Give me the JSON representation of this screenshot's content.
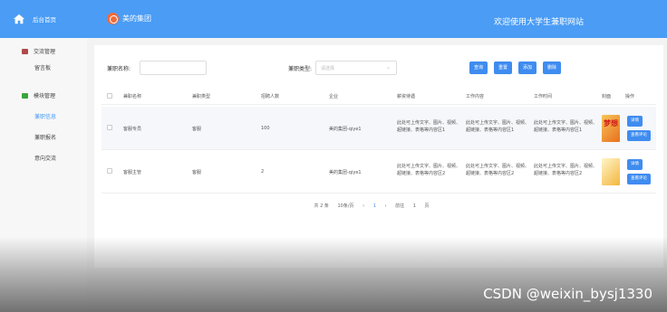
{
  "sidebar": {
    "home_label": "后台首页",
    "groups": [
      {
        "label": "交流管理",
        "items": [
          "留言板"
        ]
      },
      {
        "label": "模块管理",
        "items": [
          "兼职信息",
          "兼职报名",
          "意向交流"
        ]
      }
    ],
    "active_item": "兼职信息"
  },
  "header": {
    "brand": "美的集团",
    "welcome": "欢迎使用大学生兼职网站"
  },
  "search": {
    "name_label": "兼职名称:",
    "name_value": "",
    "type_label": "兼职类型:",
    "type_placeholder": "请选择",
    "buttons": [
      "查询",
      "重置",
      "添加",
      "删除"
    ]
  },
  "table": {
    "columns": [
      "兼职名称",
      "兼职类型",
      "招聘人数",
      "企业",
      "薪资待遇",
      "工作内容",
      "工作时间",
      "封面",
      "操作"
    ],
    "rows": [
      {
        "name": "客服专员",
        "type": "客服",
        "count": "100",
        "company": "美的集团-qiye1",
        "salary": "此处可上传文字、图片、视频、超链接、表格等内容区1",
        "content": "此处可上传文字、图片、视频、超链接、表格等内容区1",
        "time": "此处可上传文字、图片、视频、超链接、表格等内容区1",
        "cover_text": "梦想",
        "actions": [
          "详情",
          "查看评论"
        ]
      },
      {
        "name": "客服主管",
        "type": "客服",
        "count": "2",
        "company": "美的集团-qiye1",
        "salary": "此处可上传文字、图片、视频、超链接、表格等内容区2",
        "content": "此处可上传文字、图片、视频、超链接、表格等内容区2",
        "time": "此处可上传文字、图片、视频、超链接、表格等内容区2",
        "cover_text": "",
        "actions": [
          "详情",
          "查看评论"
        ]
      }
    ]
  },
  "pagination": {
    "total": "共 2 条",
    "page_size": "10条/页",
    "prev": "‹",
    "current": "1",
    "next": "›",
    "goto_label": "前往",
    "goto_value": "1",
    "page_unit": "页"
  },
  "watermark": "CSDN @weixin_bysj1330",
  "colors": {
    "primary": "#4a9cf5",
    "button": "#3f8cf0",
    "sidebar": "#3b3f4a"
  }
}
